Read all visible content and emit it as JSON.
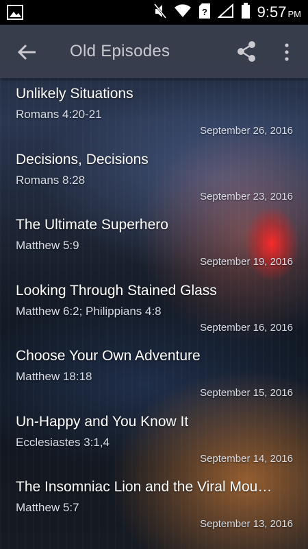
{
  "status_bar": {
    "time": "9:57",
    "ampm": "PM",
    "icons": [
      "image-icon",
      "mute-icon",
      "wifi-icon",
      "sim-unknown-icon",
      "signal-icon",
      "battery-icon"
    ]
  },
  "app_bar": {
    "title": "Old Episodes",
    "back_icon": "arrow-back-icon",
    "share_icon": "share-icon",
    "more_icon": "more-vert-icon"
  },
  "episodes": [
    {
      "title": "Unlikely Situations",
      "reference": "Romans 4:20-21",
      "date": "September 26, 2016"
    },
    {
      "title": "Decisions, Decisions",
      "reference": "Romans 8:28",
      "date": "September 23, 2016"
    },
    {
      "title": "The Ultimate Superhero",
      "reference": "Matthew 5:9",
      "date": "September 19, 2016"
    },
    {
      "title": "Looking Through Stained Glass",
      "reference": "Matthew 6:2; Philippians 4:8",
      "date": "September 16, 2016"
    },
    {
      "title": "Choose Your Own Adventure",
      "reference": "Matthew 18:18",
      "date": "September 15, 2016"
    },
    {
      "title": "Un-Happy and You Know It",
      "reference": "Ecclesiastes 3:1,4",
      "date": "September 14, 2016"
    },
    {
      "title": "The Insomniac Lion and the Viral Mou…",
      "reference": "Matthew 5:7",
      "date": "September 13, 2016"
    }
  ]
}
